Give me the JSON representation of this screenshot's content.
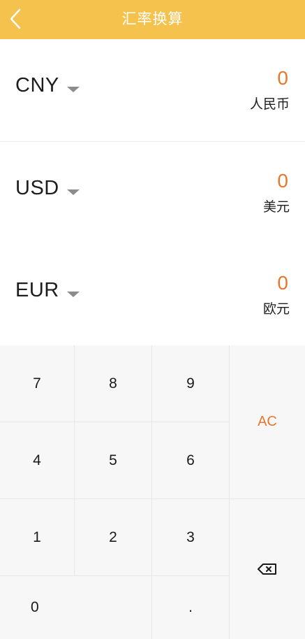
{
  "header": {
    "title": "汇率换算",
    "back_icon": "chevron-left-icon",
    "background": "#f4c24d"
  },
  "rows": [
    {
      "code": "CNY",
      "value": "0",
      "name": "人民币"
    },
    {
      "code": "USD",
      "value": "0",
      "name": "美元"
    },
    {
      "code": "EUR",
      "value": "0",
      "name": "欧元"
    }
  ],
  "accent": "#e8772e",
  "keypad": {
    "k7": "7",
    "k8": "8",
    "k9": "9",
    "k4": "4",
    "k5": "5",
    "k6": "6",
    "k1": "1",
    "k2": "2",
    "k3": "3",
    "k0": "0",
    "dot": ".",
    "clear": "AC",
    "backspace_icon": "backspace-icon"
  }
}
